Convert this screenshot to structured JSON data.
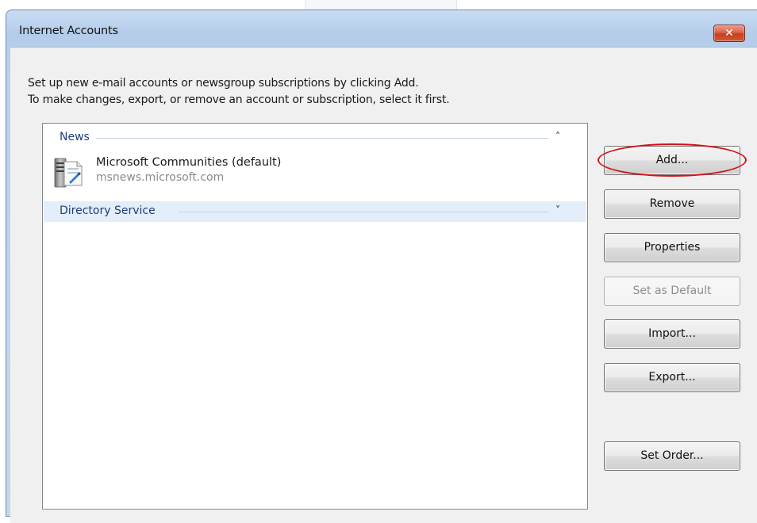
{
  "window": {
    "title": "Internet Accounts",
    "close_glyph": "✕"
  },
  "instructions": {
    "line1": "Set up new e-mail accounts or newsgroup subscriptions by clicking Add.",
    "line2": "To make changes, export, or remove an account or subscription, select it first."
  },
  "groups": [
    {
      "label": "News",
      "chevron": "˄",
      "state": "expanded",
      "items": [
        {
          "name": "Microsoft Communities (default)",
          "server": "msnews.microsoft.com",
          "icon": "news-server-icon"
        }
      ]
    },
    {
      "label": "Directory Service",
      "chevron": "˅",
      "state": "collapsed",
      "items": []
    }
  ],
  "buttons": {
    "add": "Add...",
    "remove": "Remove",
    "properties": "Properties",
    "set_default": "Set as Default",
    "import": "Import...",
    "export": "Export...",
    "set_order": "Set Order..."
  },
  "colors": {
    "annotation_highlight": "#d4121b",
    "group_header_text": "#1e3f7a",
    "selected_row": "#e3eefa"
  }
}
